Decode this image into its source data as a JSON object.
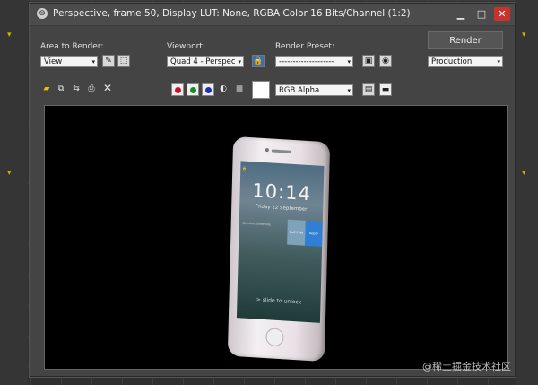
{
  "window": {
    "title": "Perspective, frame 50, Display LUT: None, RGBA Color 16 Bits/Channel (1:2)",
    "icon": "3dsmax-icon",
    "controls": {
      "minimize": "▁",
      "maximize": "□",
      "close": "✕"
    }
  },
  "toolbar": {
    "area_label": "Area to Render:",
    "area_value": "View",
    "viewport_label": "Viewport:",
    "viewport_value": "Quad 4 - Perspec",
    "preset_label": "Render Preset:",
    "preset_value": "--------------------",
    "render_label": "Render",
    "production_value": "Production",
    "channel_value": "RGB Alpha",
    "dropdown_arrow": "▾"
  },
  "channels": {
    "red": "#c8102e",
    "green": "#1a8a2a",
    "blue": "#1c2fbf"
  },
  "phone": {
    "time": "10:14",
    "date": "Friday 12 September",
    "notification": "Jasmine Simmons",
    "button_left": "Call PFW",
    "button_right": "Reply",
    "slide_text": "> slide to unlock"
  },
  "watermark": "@稀土掘金技术社区",
  "colors": {
    "close_button": "#c8332b",
    "render_bg": "#000000",
    "accent_blue": "#2f7fd4"
  }
}
